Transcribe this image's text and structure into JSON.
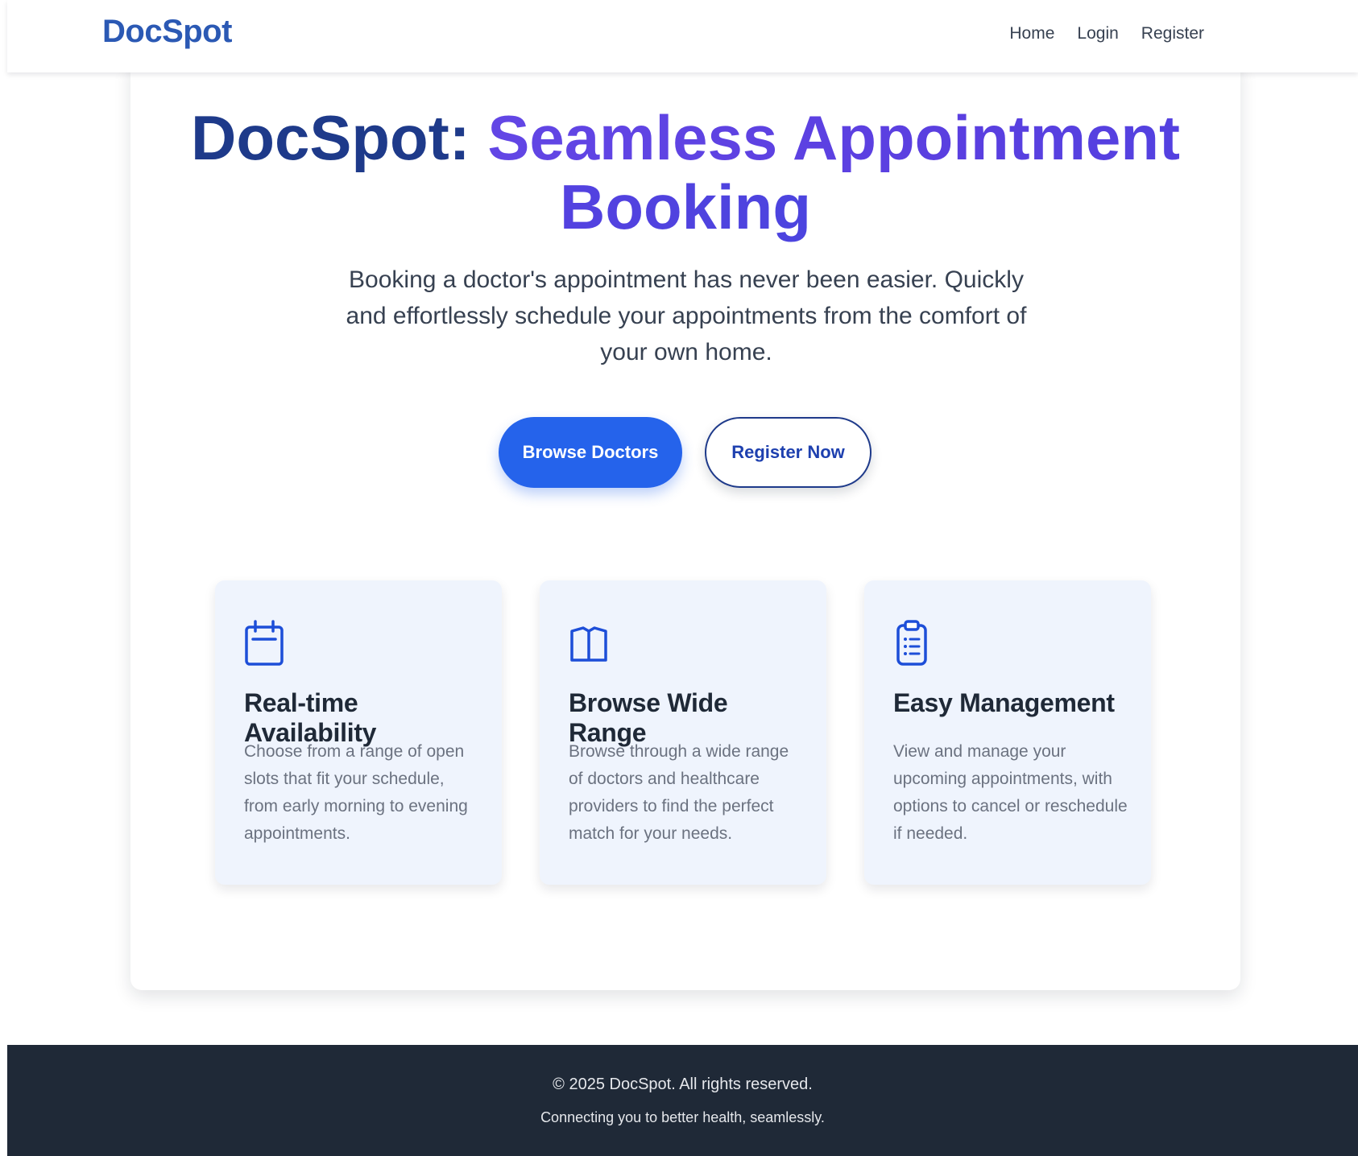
{
  "nav": {
    "brand": "DocSpot",
    "links": [
      "Home",
      "Login",
      "Register"
    ]
  },
  "hero": {
    "title_part1": "DocSpot: ",
    "title_part2": "Seamless Appointment Booking",
    "subtitle": "Booking a doctor's appointment has never been easier. Quickly and effortlessly schedule your appointments from the comfort of your own home.",
    "primary_button": "Browse Doctors",
    "secondary_button": "Register Now"
  },
  "features": [
    {
      "icon": "calendar-icon",
      "title": "Real-time Availability",
      "text": "Choose from a range of open slots that fit your schedule, from early morning to evening appointments."
    },
    {
      "icon": "book-icon",
      "title": "Browse Wide Range",
      "text": "Browse through a wide range of doctors and healthcare providers to find the perfect match for your needs."
    },
    {
      "icon": "clipboard-list-icon",
      "title": "Easy Management",
      "text": "View and manage your upcoming appointments, with options to cancel or reschedule if needed."
    }
  ],
  "footer": {
    "copyright": "© 2025 DocSpot. All rights reserved.",
    "tagline": "Connecting you to better health, seamlessly."
  },
  "colors": {
    "brand": "#2b59b4",
    "title_dark": "#1e3a8a",
    "title_accent": "#6246e5",
    "primary_button": "#2563eb",
    "feature_card": "#eff4fd",
    "footer_bg": "#1f2937"
  }
}
